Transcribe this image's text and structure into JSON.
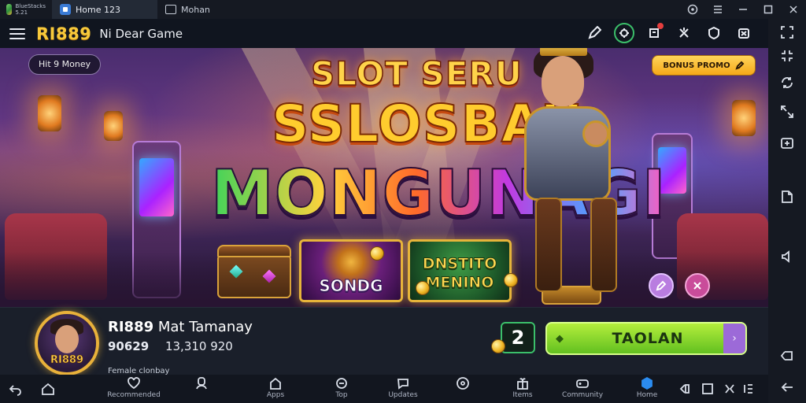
{
  "titlebar": {
    "app_mini_text": "BlueStacks\n5.21",
    "tabs": [
      {
        "label": "Home 123",
        "active": true
      },
      {
        "label": "Mohan",
        "active": false
      }
    ],
    "window_controls": [
      "help-icon",
      "menu-icon",
      "minimize-icon",
      "maximize-icon",
      "close-icon"
    ]
  },
  "appbar": {
    "brand": "RI889",
    "subtitle": "Ni Dear Game"
  },
  "banner": {
    "players_pill": "Hit 9 Money",
    "promo_pill": "BONUS PROMO",
    "title_line1": "SLOT SERU",
    "title_line2": "SSLOSBAU",
    "title_line3": "MONGUNAGI",
    "tile_a_label": "SONDG",
    "tile_b_label_1": "DNSTITO",
    "tile_b_label_2": "MENINO"
  },
  "game": {
    "avatar_text": "RI889",
    "title_bold": "RI889",
    "title_rest": "Mat Tamanay",
    "rating": "90629",
    "downloads": "13,310 920",
    "developer": "Female clonbay",
    "counter": "2",
    "play_label": "TAOLAN"
  },
  "bottom_nav": [
    {
      "label": "Recommended",
      "icon": "heart-icon"
    },
    {
      "label": "",
      "icon": "user-icon"
    },
    {
      "label": "Apps",
      "icon": "home-icon"
    },
    {
      "label": "Top",
      "icon": "game-icon"
    },
    {
      "label": "Updates",
      "icon": "chat-icon"
    },
    {
      "label": "",
      "icon": "disc-icon"
    },
    {
      "label": "Items",
      "icon": "gift-icon"
    },
    {
      "label": "Community",
      "icon": "controller-icon"
    },
    {
      "label": "Home",
      "icon": "cube-icon",
      "active": true
    }
  ],
  "colors": {
    "brand_gold": "#f7c93b",
    "play_green": "#62c020",
    "accent_blue": "#2b8cf0"
  }
}
